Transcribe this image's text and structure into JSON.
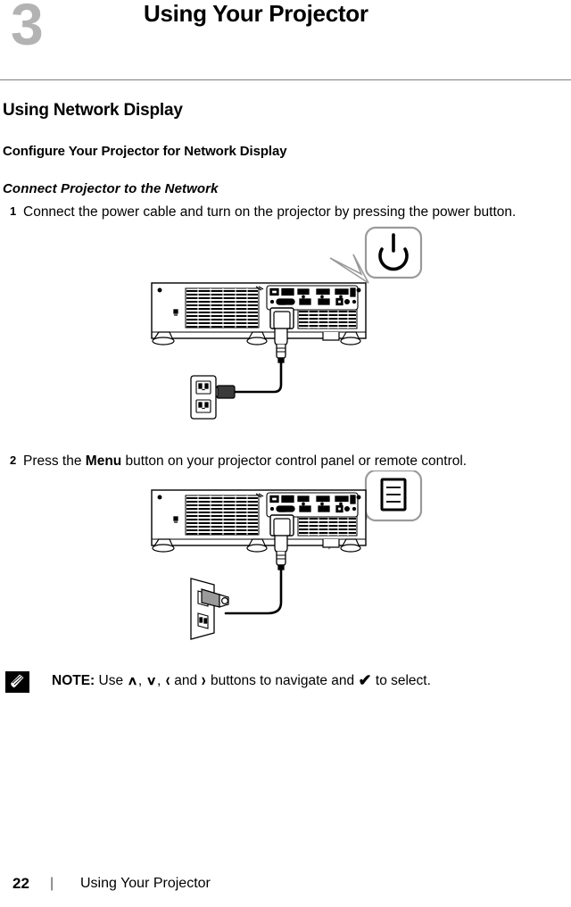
{
  "chapter": {
    "number": "3",
    "title": "Using Your Projector"
  },
  "headings": {
    "h1": "Using Network Display",
    "h2": "Configure Your Projector for Network Display",
    "h3": "Connect Projector to the Network"
  },
  "steps": [
    {
      "number": "1",
      "text_before": "Connect the power cable and turn on the projector by pressing the power button.",
      "bold": "",
      "text_after": ""
    },
    {
      "number": "2",
      "text_before": "Press the ",
      "bold": "Menu",
      "text_after": " button on your projector control panel or remote control."
    }
  ],
  "figures": [
    {
      "name": "projector-power-connection",
      "callout_icon": "power-icon",
      "outlet_style": "duplex-flat"
    },
    {
      "name": "projector-menu-button",
      "callout_icon": "menu-icon",
      "outlet_style": "wall-perspective"
    }
  ],
  "note": {
    "icon": "note-pencil-icon",
    "label": "NOTE:",
    "text_1": " Use ",
    "glyph_up": "∧",
    "sep_1": ", ",
    "glyph_down": "∨",
    "sep_2": ", ",
    "glyph_left": "‹",
    "text_2": " and ",
    "glyph_right": "›",
    "text_3": " buttons to navigate and ",
    "glyph_check": "✔",
    "text_4": " to select."
  },
  "footer": {
    "page_number": "22",
    "separator": "|",
    "title": "Using Your Projector"
  },
  "colors": {
    "chapter_number": "#b3b3b3",
    "rule": "#808080",
    "callout_border": "#9a9a9a",
    "ink": "#000000"
  }
}
